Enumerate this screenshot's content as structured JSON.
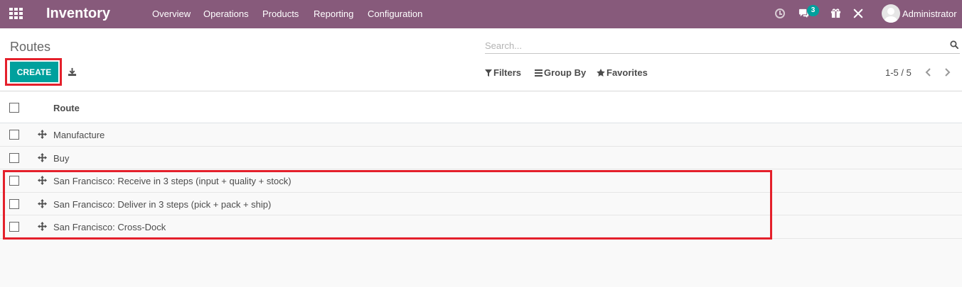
{
  "navbar": {
    "brand": "Inventory",
    "menu": [
      "Overview",
      "Operations",
      "Products",
      "Reporting",
      "Configuration"
    ],
    "message_count": "3",
    "user_name": "Administrator",
    "bg_color": "#875a7b"
  },
  "control_panel": {
    "breadcrumb": "Routes",
    "search_placeholder": "Search...",
    "create_label": "CREATE",
    "filters_label": "Filters",
    "group_by_label": "Group By",
    "favorites_label": "Favorites",
    "pager_value": "1-5 / 5",
    "accent_color": "#00a09d"
  },
  "list": {
    "column_route": "Route",
    "rows": [
      "Manufacture",
      "Buy",
      "San Francisco: Receive in 3 steps (input + quality + stock)",
      "San Francisco: Deliver in 3 steps (pick + pack + ship)",
      "San Francisco: Cross-Dock"
    ]
  },
  "annotations": {
    "highlight_color": "#e4202b"
  }
}
